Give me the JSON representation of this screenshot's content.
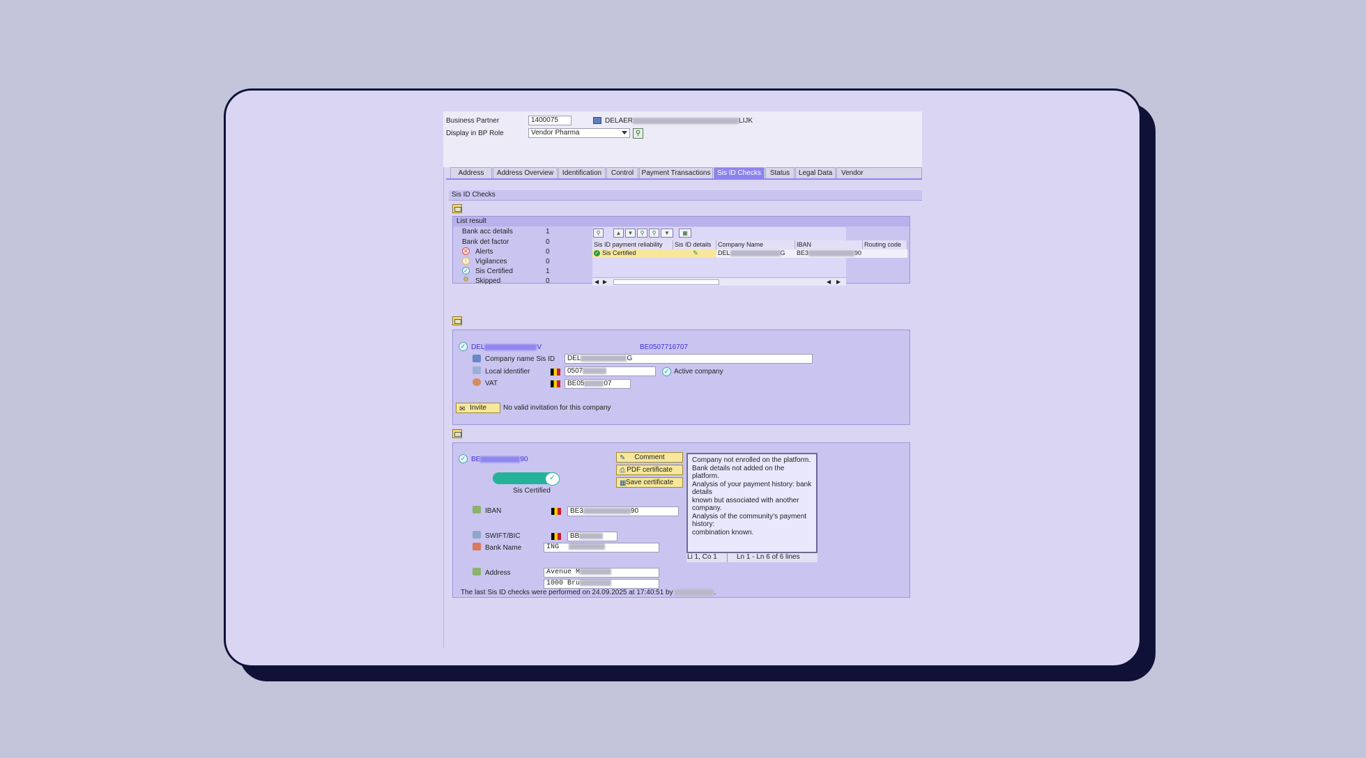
{
  "header": {
    "business_partner_label": "Business Partner",
    "business_partner_value": "1400075",
    "business_partner_name_start": "DELAER",
    "business_partner_name_end": "LIJK",
    "display_role_label": "Display in BP Role",
    "display_role_value": "Vendor Pharma"
  },
  "tabs": [
    "Address",
    "Address Overview",
    "Identification",
    "Control",
    "Payment Transactions",
    "Sis ID Checks",
    "Status",
    "Legal Data",
    "Vendor"
  ],
  "active_tab": "Sis ID Checks",
  "section_title": "Sis ID Checks",
  "list_result": {
    "title": "List result",
    "rows": [
      {
        "label": "Bank acc details",
        "count": "1",
        "icon": "none"
      },
      {
        "label": "Bank det factor",
        "count": "0",
        "icon": "none"
      },
      {
        "label": "Alerts",
        "count": "0",
        "icon": "alert-x-icon"
      },
      {
        "label": "Vigilances",
        "count": "0",
        "icon": "vigilance-icon"
      },
      {
        "label": "Sis Certified",
        "count": "1",
        "icon": "certified-check-icon"
      },
      {
        "label": "Skipped",
        "count": "0",
        "icon": "skipped-icon"
      }
    ],
    "table": {
      "columns": [
        "Sis ID payment reliability",
        "Sis ID details",
        "Company Name",
        "IBAN",
        "Routing code"
      ],
      "row": {
        "reliability": "Sis Certified",
        "company_start": "DEL",
        "company_end": "G",
        "iban_start": "BE3",
        "iban_end": "90"
      }
    }
  },
  "company": {
    "name_start": "DEL",
    "name_end": "V",
    "vat_link": "BE0507716707",
    "company_name_label": "Company name Sis ID",
    "company_name_start": "DEL",
    "company_name_end": "G",
    "local_identifier_label": "Local identifier",
    "local_identifier_start": "0507",
    "active_company_label": "Active company",
    "vat_label": "VAT",
    "vat_start": "BE05",
    "vat_end": "07",
    "invite_label": "Invite",
    "invite_message": "No valid invitation for this company"
  },
  "bank": {
    "iban_start": "BE",
    "iban_end": "90",
    "certified_label": "Sis Certified",
    "comment_button": "Comment",
    "pdf_button": "PDF certificate",
    "save_button": "Save certificate",
    "iban_label": "IBAN",
    "iban_field_start": "BE3",
    "iban_field_end": "90",
    "swift_label": "SWIFT/BIC",
    "swift_start": "BB",
    "bank_name_label": "Bank Name",
    "bank_name_start": "ING",
    "address_label": "Address",
    "address_line1_start": "Avenue M",
    "address_line2_start": "1000 Bru",
    "info_lines": [
      "Company not enrolled on the platform.",
      "Bank details not added on the platform.",
      "Analysis of your payment history: bank details",
      "known but associated with another company.",
      "Analysis of the community's payment history:",
      "combination known."
    ],
    "cursor_position": "Li 1, Co 1",
    "line_range": "Ln 1 - Ln 6 of 6 lines",
    "last_check_text": "The last Sis ID checks were performed on 24.09.2025 at 17:40:51 by"
  },
  "colors": {
    "background": "#c3c6da",
    "card": "#d9d5f3",
    "card_border": "#0f1236",
    "active_tab": "#8c84ee",
    "certified_toggle": "#24b39a",
    "link_blue": "#3f2fd6"
  }
}
